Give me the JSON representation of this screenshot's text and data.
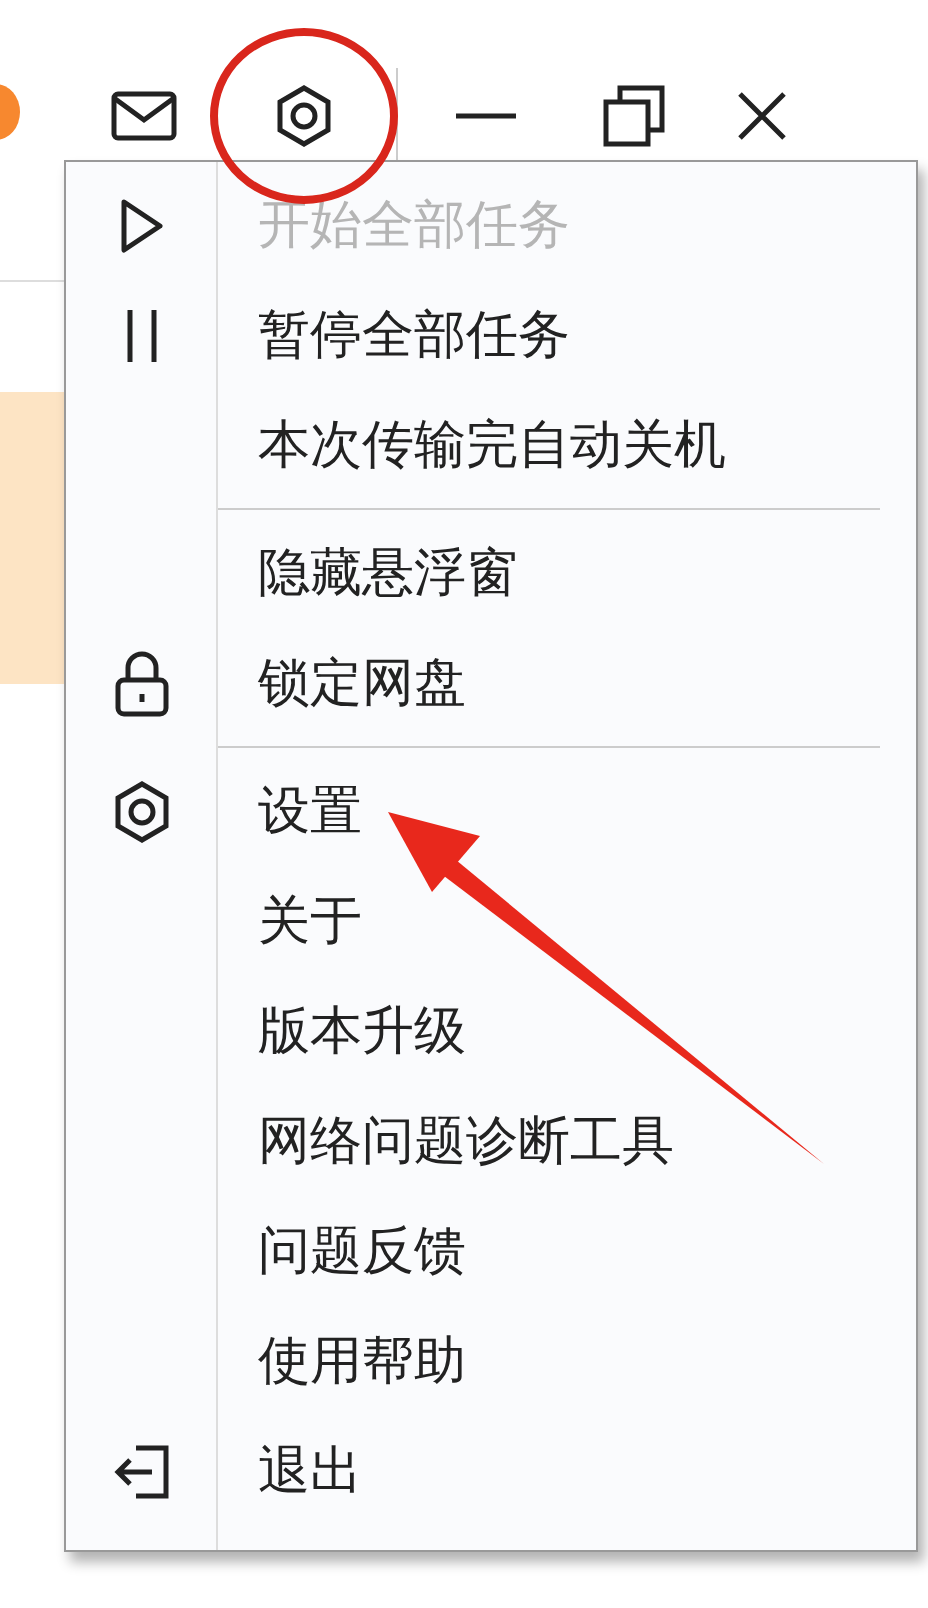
{
  "menu": {
    "groups": [
      [
        {
          "label": "开始全部任务",
          "disabled": true
        },
        {
          "label": "暂停全部任务",
          "disabled": false
        },
        {
          "label": "本次传输完自动关机",
          "disabled": false
        }
      ],
      [
        {
          "label": "隐藏悬浮窗",
          "disabled": false
        },
        {
          "label": "锁定网盘",
          "disabled": false
        }
      ],
      [
        {
          "label": "设置",
          "disabled": false
        },
        {
          "label": "关于",
          "disabled": false
        },
        {
          "label": "版本升级",
          "disabled": false
        },
        {
          "label": "网络问题诊断工具",
          "disabled": false
        },
        {
          "label": "问题反馈",
          "disabled": false
        },
        {
          "label": "使用帮助",
          "disabled": false
        },
        {
          "label": "退出",
          "disabled": false
        }
      ]
    ]
  }
}
